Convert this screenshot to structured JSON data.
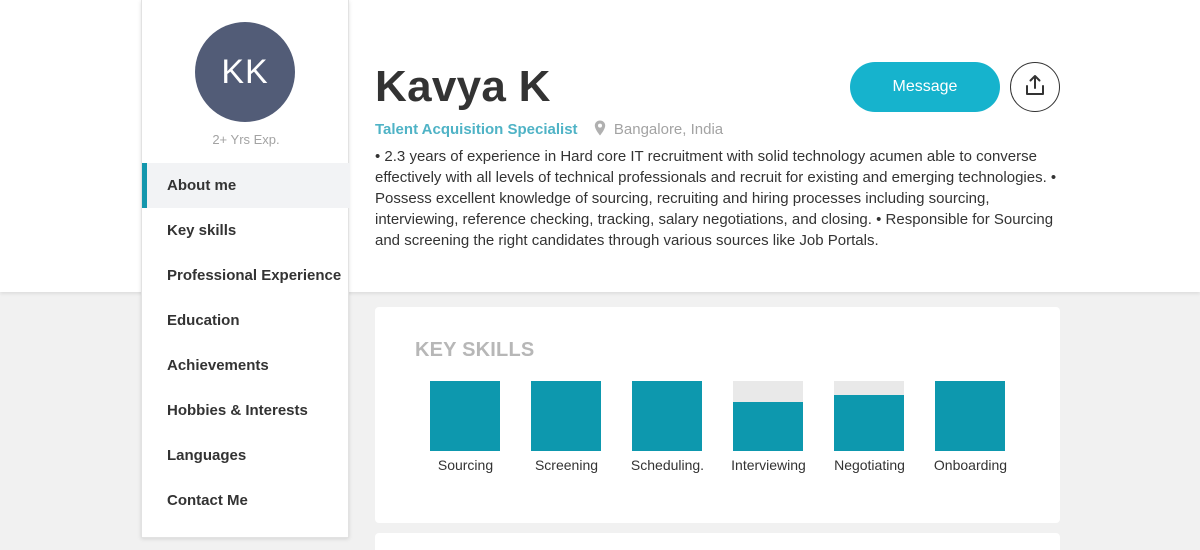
{
  "profile": {
    "initials": "KK",
    "experience": "2+ Yrs Exp.",
    "name": "Kavya K",
    "role": "Talent Acquisition Specialist",
    "location": "Bangalore, India",
    "about": "• 2.3 years of experience in Hard core IT recruitment with solid technology acumen able to converse effectively with all levels of technical professionals and recruit for existing and emerging technologies. • Possess excellent knowledge of sourcing, recruiting and hiring processes including sourcing, interviewing, reference checking, tracking, salary negotiations, and closing. • Responsible for Sourcing and screening the right candidates through various sources like Job Portals."
  },
  "actions": {
    "message_label": "Message",
    "share_icon": "share-icon"
  },
  "sidebar": {
    "items": [
      {
        "label": "About me",
        "active": true
      },
      {
        "label": "Key skills",
        "active": false
      },
      {
        "label": "Professional Experience",
        "active": false
      },
      {
        "label": "Education",
        "active": false
      },
      {
        "label": "Achievements",
        "active": false
      },
      {
        "label": "Hobbies & Interests",
        "active": false
      },
      {
        "label": "Languages",
        "active": false
      },
      {
        "label": "Contact Me",
        "active": false
      }
    ]
  },
  "skills": {
    "title": "KEY SKILLS",
    "items": [
      {
        "label": "Sourcing",
        "level": 1.0
      },
      {
        "label": "Screening",
        "level": 1.0
      },
      {
        "label": "Scheduling.",
        "level": 1.0
      },
      {
        "label": "Interviewing",
        "level": 0.7
      },
      {
        "label": "Negotiating",
        "level": 0.8
      },
      {
        "label": "Onboarding",
        "level": 1.0
      }
    ]
  },
  "colors": {
    "accent": "#16b3cd",
    "skill_fill": "#0d98ae",
    "avatar_bg": "#525c77",
    "role_text": "#4fb3c6"
  }
}
